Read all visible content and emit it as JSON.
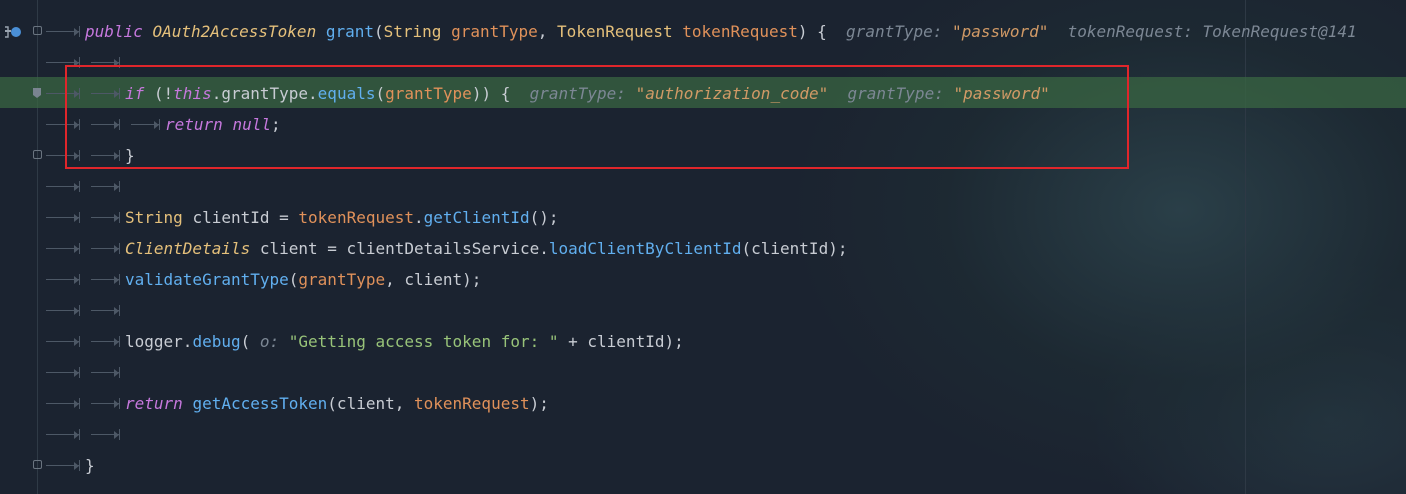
{
  "editor": {
    "lines": [
      {
        "id": "l1",
        "tokens": [
          {
            "c": "kw",
            "t": "public "
          },
          {
            "c": "type ital",
            "t": "OAuth2AccessToken "
          },
          {
            "c": "method",
            "t": "grant"
          },
          {
            "c": "fld",
            "t": "("
          },
          {
            "c": "type",
            "t": "String "
          },
          {
            "c": "param",
            "t": "grantType"
          },
          {
            "c": "fld",
            "t": ", "
          },
          {
            "c": "type",
            "t": "TokenRequest "
          },
          {
            "c": "param",
            "t": "tokenRequest"
          },
          {
            "c": "fld",
            "t": ") {  "
          },
          {
            "c": "hint",
            "t": "grantType: "
          },
          {
            "c": "hint-val",
            "t": "\"password\""
          },
          {
            "c": "hint",
            "t": "  tokenRequest: TokenRequest@141"
          }
        ]
      },
      {
        "id": "l2",
        "tokens": []
      },
      {
        "id": "l3",
        "tokens": [
          {
            "c": "kw",
            "t": "if "
          },
          {
            "c": "fld",
            "t": "(!"
          },
          {
            "c": "kw",
            "t": "this"
          },
          {
            "c": "fld",
            "t": ".grantType."
          },
          {
            "c": "method",
            "t": "equals"
          },
          {
            "c": "fld",
            "t": "("
          },
          {
            "c": "param",
            "t": "grantType"
          },
          {
            "c": "fld",
            "t": ")) {  "
          },
          {
            "c": "hint",
            "t": "grantType: "
          },
          {
            "c": "hint-val",
            "t": "\"authorization_code\""
          },
          {
            "c": "hint",
            "t": "  grantType: "
          },
          {
            "c": "hint-val",
            "t": "\"password\""
          }
        ]
      },
      {
        "id": "l4",
        "tokens": [
          {
            "c": "kw",
            "t": "return "
          },
          {
            "c": "kw",
            "t": "null"
          },
          {
            "c": "fld",
            "t": ";"
          }
        ]
      },
      {
        "id": "l5",
        "tokens": [
          {
            "c": "fld",
            "t": "}"
          }
        ]
      },
      {
        "id": "l6",
        "tokens": []
      },
      {
        "id": "l7",
        "tokens": [
          {
            "c": "type",
            "t": "String "
          },
          {
            "c": "fld",
            "t": "clientId = "
          },
          {
            "c": "param",
            "t": "tokenRequest"
          },
          {
            "c": "fld",
            "t": "."
          },
          {
            "c": "method",
            "t": "getClientId"
          },
          {
            "c": "fld",
            "t": "();"
          }
        ]
      },
      {
        "id": "l8",
        "tokens": [
          {
            "c": "type ital",
            "t": "ClientDetails "
          },
          {
            "c": "fld",
            "t": "client = clientDetailsService."
          },
          {
            "c": "method",
            "t": "loadClientByClientId"
          },
          {
            "c": "fld",
            "t": "(clientId);"
          }
        ]
      },
      {
        "id": "l9",
        "tokens": [
          {
            "c": "method",
            "t": "validateGrantType"
          },
          {
            "c": "fld",
            "t": "("
          },
          {
            "c": "param",
            "t": "grantType"
          },
          {
            "c": "fld",
            "t": ", client);"
          }
        ]
      },
      {
        "id": "l10",
        "tokens": []
      },
      {
        "id": "l11",
        "tokens": [
          {
            "c": "fld",
            "t": "logger."
          },
          {
            "c": "method",
            "t": "debug"
          },
          {
            "c": "fld",
            "t": "( "
          },
          {
            "c": "hint",
            "t": "o: "
          },
          {
            "c": "str",
            "t": "\"Getting access token for: \""
          },
          {
            "c": "fld",
            "t": " + clientId);"
          }
        ]
      },
      {
        "id": "l12",
        "tokens": []
      },
      {
        "id": "l13",
        "tokens": [
          {
            "c": "kw",
            "t": "return "
          },
          {
            "c": "method",
            "t": "getAccessToken"
          },
          {
            "c": "fld",
            "t": "(client, "
          },
          {
            "c": "param",
            "t": "tokenRequest"
          },
          {
            "c": "fld",
            "t": ");"
          }
        ]
      },
      {
        "id": "l14",
        "tokens": []
      },
      {
        "id": "l15",
        "tokens": [
          {
            "c": "fld",
            "t": "}"
          }
        ]
      }
    ]
  },
  "colors": {
    "background": "#1b2330",
    "highlight_line": "#3a6842",
    "highlight_box": "#e0262b",
    "keyword": "#c678dd",
    "type": "#e5c07b",
    "method": "#61afef",
    "parameter": "#e0915a",
    "string": "#98c379",
    "hint": "#7c8794",
    "hint_value": "#d19a66"
  },
  "icons": {
    "gutter_debug": "debug-step-icon",
    "breakpoint": "breakpoint-icon",
    "fold": "fold-marker-icon"
  }
}
